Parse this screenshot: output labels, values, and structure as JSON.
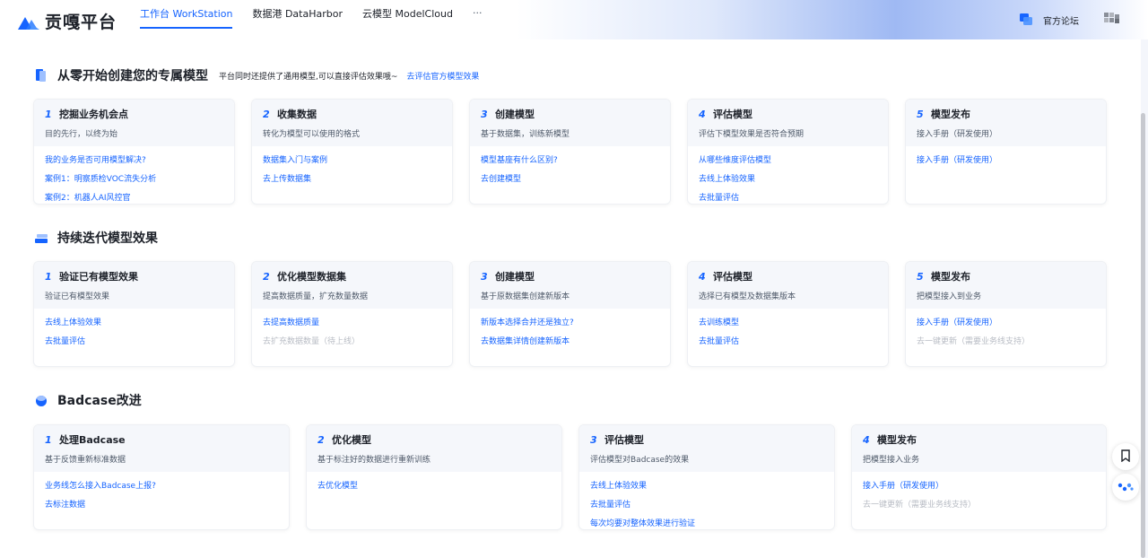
{
  "app": {
    "logo_text": "贡嘎平台"
  },
  "nav": {
    "tabs": [
      {
        "label": "工作台 WorkStation",
        "active": true
      },
      {
        "label": "数据港 DataHarbor",
        "active": false
      },
      {
        "label": "云模型 ModelCloud",
        "active": false
      }
    ],
    "more": "···"
  },
  "header_right": {
    "forum_label": "官方论坛"
  },
  "colors": {
    "accent": "#1664ff",
    "disabled": "#b8bcc4"
  },
  "sections": [
    {
      "title": "从零开始创建您的专属模型",
      "subtitle": "平台同时还提供了通用模型,可以直接评估效果哦~",
      "link": "去评估官方模型效果",
      "icon": "book-icon",
      "cards": [
        {
          "num": "1",
          "title": "挖掘业务机会点",
          "desc": "目的先行，以终为始",
          "links": [
            {
              "text": "我的业务是否可用模型解决?",
              "enabled": true
            },
            {
              "text": "案例1：明察质检VOC流失分析",
              "enabled": true
            },
            {
              "text": "案例2：机器人AI风控官",
              "enabled": true
            }
          ]
        },
        {
          "num": "2",
          "title": "收集数据",
          "desc": "转化为模型可以使用的格式",
          "links": [
            {
              "text": "数据集入门与案例",
              "enabled": true
            },
            {
              "text": "去上传数据集",
              "enabled": true
            }
          ]
        },
        {
          "num": "3",
          "title": "创建模型",
          "desc": "基于数据集，训练新模型",
          "links": [
            {
              "text": "模型基座有什么区别?",
              "enabled": true
            },
            {
              "text": "去创建模型",
              "enabled": true
            }
          ]
        },
        {
          "num": "4",
          "title": "评估模型",
          "desc": "评估下模型效果是否符合预期",
          "links": [
            {
              "text": "从哪些维度评估模型",
              "enabled": true
            },
            {
              "text": "去线上体验效果",
              "enabled": true
            },
            {
              "text": "去批量评估",
              "enabled": true
            }
          ]
        },
        {
          "num": "5",
          "title": "模型发布",
          "desc": "接入手册（研发使用）",
          "links": [
            {
              "text": "接入手册（研发使用）",
              "enabled": true
            }
          ]
        }
      ]
    },
    {
      "title": "持续迭代模型效果",
      "icon": "layers-icon",
      "cards": [
        {
          "num": "1",
          "title": "验证已有模型效果",
          "desc": "验证已有模型效果",
          "links": [
            {
              "text": "去线上体验效果",
              "enabled": true
            },
            {
              "text": "去批量评估",
              "enabled": true
            }
          ]
        },
        {
          "num": "2",
          "title": "优化模型数据集",
          "desc": "提高数据质量，扩充数量数据",
          "links": [
            {
              "text": "去提高数据质量",
              "enabled": true
            },
            {
              "text": "去扩充数据数量（待上线）",
              "enabled": false
            }
          ]
        },
        {
          "num": "3",
          "title": "创建模型",
          "desc": "基于原数据集创建新版本",
          "links": [
            {
              "text": "新版本选择合并还是独立?",
              "enabled": true
            },
            {
              "text": "去数据集详情创建新版本",
              "enabled": true
            }
          ]
        },
        {
          "num": "4",
          "title": "评估模型",
          "desc": "选择已有模型及数据集版本",
          "links": [
            {
              "text": "去训练模型",
              "enabled": true
            },
            {
              "text": "去批量评估",
              "enabled": true
            }
          ]
        },
        {
          "num": "5",
          "title": "模型发布",
          "desc": "把模型接入到业务",
          "links": [
            {
              "text": "接入手册（研发使用）",
              "enabled": true
            },
            {
              "text": "去一键更新（需要业务线支持）",
              "enabled": false
            }
          ]
        }
      ]
    },
    {
      "title": "Badcase改进",
      "icon": "globe-icon",
      "cards": [
        {
          "num": "1",
          "title": "处理Badcase",
          "desc": "基于反馈重新标准数据",
          "links": [
            {
              "text": "业务线怎么接入Badcase上报?",
              "enabled": true
            },
            {
              "text": "去标注数据",
              "enabled": true
            }
          ]
        },
        {
          "num": "2",
          "title": "优化模型",
          "desc": "基于标注好的数据进行重新训练",
          "links": [
            {
              "text": "去优化模型",
              "enabled": true
            }
          ]
        },
        {
          "num": "3",
          "title": "评估模型",
          "desc": "评估模型对Badcase的效果",
          "links": [
            {
              "text": "去线上体验效果",
              "enabled": true
            },
            {
              "text": "去批量评估",
              "enabled": true
            },
            {
              "text": "每次均要对整体效果进行验证",
              "enabled": true
            }
          ]
        },
        {
          "num": "4",
          "title": "模型发布",
          "desc": "把模型接入业务",
          "links": [
            {
              "text": "接入手册（研发使用）",
              "enabled": true
            },
            {
              "text": "去一键更新（需要业务线支持）",
              "enabled": false
            }
          ]
        }
      ]
    }
  ]
}
